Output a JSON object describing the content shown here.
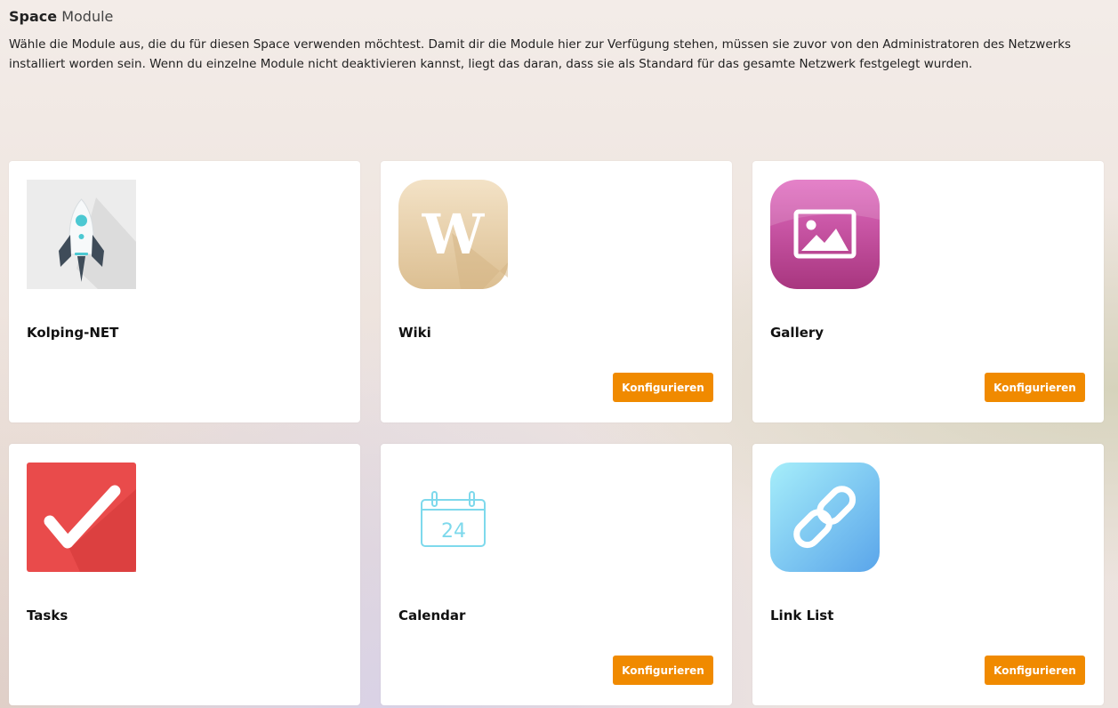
{
  "header": {
    "title_strong": "Space",
    "title_light": "Module",
    "description": "Wähle die Module aus, die du für diesen Space verwenden möchtest. Damit dir die Module hier zur Verfügung stehen, müssen sie zuvor von den Administratoren des Netzwerks installiert worden sein. Wenn du einzelne Module nicht deaktivieren kannst, liegt das daran, dass sie als Standard für das gesamte Netzwerk festgelegt wurden."
  },
  "modules": [
    {
      "name": "Kolping-NET",
      "icon": "rocket-icon",
      "configure_label": ""
    },
    {
      "name": "Wiki",
      "icon": "wiki-icon",
      "configure_label": "Konfigurieren"
    },
    {
      "name": "Gallery",
      "icon": "gallery-icon",
      "configure_label": "Konfigurieren"
    },
    {
      "name": "Tasks",
      "icon": "checkmark-icon",
      "configure_label": ""
    },
    {
      "name": "Calendar",
      "icon": "calendar-icon",
      "configure_label": "Konfigurieren",
      "calendar_day": "24"
    },
    {
      "name": "Link List",
      "icon": "link-icon",
      "configure_label": "Konfigurieren"
    }
  ],
  "colors": {
    "button": "#f08a00",
    "card": "#ffffff"
  }
}
